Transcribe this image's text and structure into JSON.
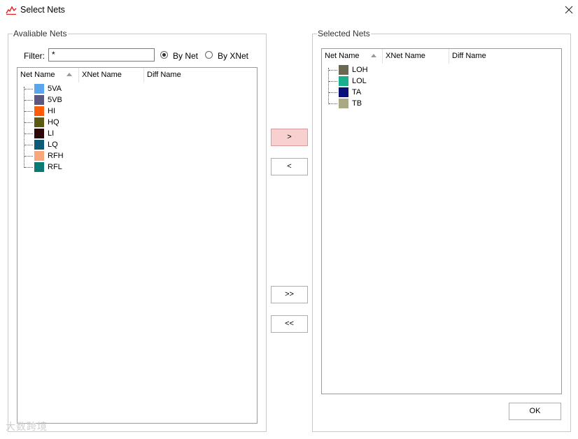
{
  "window": {
    "title": "Select Nets"
  },
  "available": {
    "group_label": "Avaliable Nets",
    "filter_label": "Filter:",
    "filter_value": "*",
    "radio_by_net": "By Net",
    "radio_by_xnet": "By XNet",
    "selected_mode": "By Net",
    "columns": [
      "Net Name",
      "XNet Name",
      "Diff Name"
    ],
    "items": [
      {
        "label": "5VA",
        "color": "#5aa6ee"
      },
      {
        "label": "5VB",
        "color": "#5d5880"
      },
      {
        "label": "HI",
        "color": "#ff5c0a"
      },
      {
        "label": "HQ",
        "color": "#5b5a12"
      },
      {
        "label": "LI",
        "color": "#2c0808"
      },
      {
        "label": "LQ",
        "color": "#0e5b78"
      },
      {
        "label": "RFH",
        "color": "#f7a77a"
      },
      {
        "label": "RFL",
        "color": "#0a7a74"
      }
    ]
  },
  "selected": {
    "group_label": "Selected Nets",
    "columns": [
      "Net Name",
      "XNet Name",
      "Diff Name"
    ],
    "items": [
      {
        "label": "LOH",
        "color": "#6a6850"
      },
      {
        "label": "LOL",
        "color": "#19ae8e"
      },
      {
        "label": "TA",
        "color": "#0a0e78"
      },
      {
        "label": "TB",
        "color": "#aaaa82"
      }
    ]
  },
  "buttons": {
    "add": ">",
    "remove": "<",
    "add_all": ">>",
    "remove_all": "<<",
    "ok": "OK"
  },
  "watermark": "大数跨境"
}
